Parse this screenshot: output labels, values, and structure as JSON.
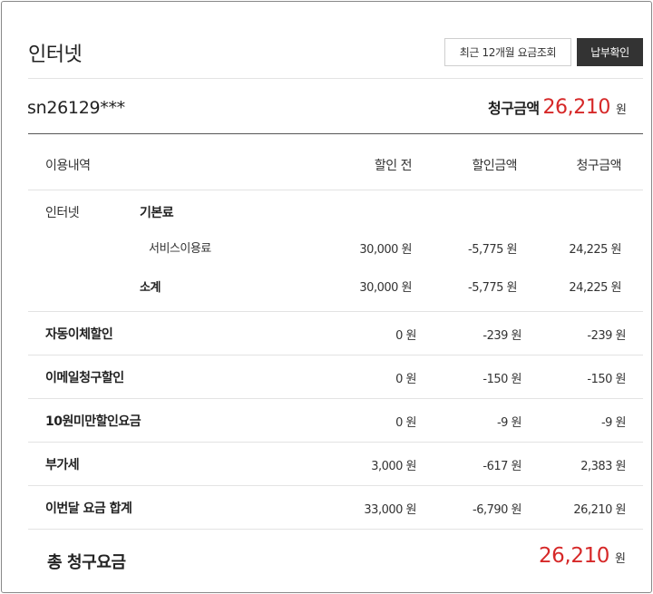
{
  "header": {
    "title": "인터넷",
    "history_button": "최근 12개월 요금조회",
    "pay_button": "납부확인"
  },
  "account": {
    "id": "sn26129***",
    "bill_label": "청구금액",
    "bill_value": "26,210",
    "bill_unit": "원"
  },
  "table": {
    "columns": [
      "이용내역",
      "할인 전",
      "할인금액",
      "청구금액"
    ],
    "internet_group": {
      "label": "인터넷",
      "base_label": "기본료",
      "service": {
        "label": "서비스이용료",
        "before": "30,000 원",
        "discount": "-5,775 원",
        "billed": "24,225 원"
      },
      "subtotal": {
        "label": "소계",
        "before": "30,000 원",
        "discount": "-5,775 원",
        "billed": "24,225 원"
      }
    },
    "rows": [
      {
        "label": "자동이체할인",
        "before": "0 원",
        "discount": "-239 원",
        "billed": "-239 원"
      },
      {
        "label": "이메일청구할인",
        "before": "0 원",
        "discount": "-150 원",
        "billed": "-150 원"
      },
      {
        "label": "10원미만할인요금",
        "before": "0 원",
        "discount": "-9 원",
        "billed": "-9 원"
      },
      {
        "label": "부가세",
        "before": "3,000 원",
        "discount": "-617 원",
        "billed": "2,383 원"
      },
      {
        "label": "이번달 요금 합계",
        "before": "33,000 원",
        "discount": "-6,790 원",
        "billed": "26,210 원"
      }
    ]
  },
  "total": {
    "label": "총 청구요금",
    "value": "26,210",
    "unit": "원"
  },
  "colors": {
    "accent_red": "#d62828",
    "dark_button": "#333333"
  }
}
